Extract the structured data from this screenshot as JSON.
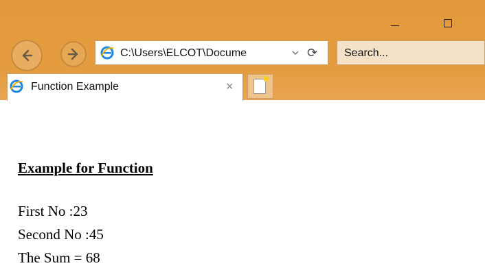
{
  "window": {
    "minimize_icon": "minimize-icon",
    "maximize_icon": "maximize-icon"
  },
  "toolbar": {
    "address": "C:\\Users\\ELCOT\\Docume",
    "search_placeholder": "Search..."
  },
  "tabs": [
    {
      "title": "Function Example"
    }
  ],
  "page": {
    "heading": "Example for Function",
    "lines": [
      "First No :23",
      "Second No :45",
      "The Sum = 68"
    ]
  }
}
